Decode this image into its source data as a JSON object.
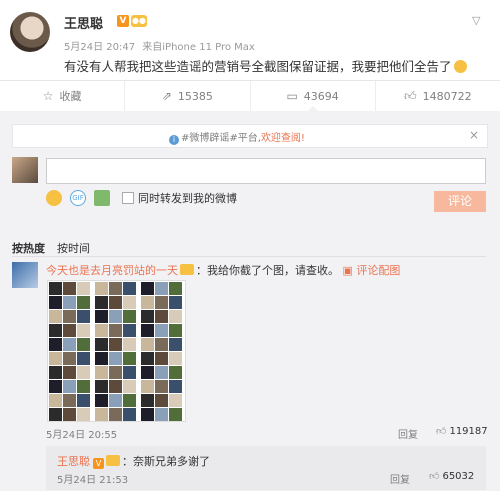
{
  "post": {
    "author": "王思聪",
    "verified_badge": "V",
    "meta_time": "5月24日 20:47",
    "meta_source_prefix": "来自",
    "meta_device": "iPhone 11 Pro Max",
    "text": "有没有人帮我把这些造谣的营销号全截图保留证据，我要把他们全告了",
    "icons": {
      "avatar": "avatar",
      "dropdown": "chevron-down-icon",
      "emoji": "smile-emoji"
    }
  },
  "actions": [
    {
      "label": "收藏",
      "icon": "star-icon"
    },
    {
      "label": "15385",
      "icon": "share-icon"
    },
    {
      "label": "43694",
      "icon": "comment-icon"
    },
    {
      "label": "1480722",
      "icon": "thumbs-up-icon"
    }
  ],
  "notice": {
    "text_prefix": "#微博辟谣#平台,",
    "link": "欢迎查阅!"
  },
  "composer": {
    "input_value": "",
    "repost_checkbox_label": "同时转发到我的微博",
    "send_label": "评论"
  },
  "sort": {
    "hot": "按热度",
    "time": "按时间"
  },
  "comment": {
    "nick": "今天也是去月亮罚站的一天",
    "text": "：我给你截了个图，请查收。",
    "pic_link": "评论配图",
    "date": "5月24日 20:55",
    "reply_label": "回复",
    "likes": "119187"
  },
  "reply": {
    "nick": "王思聪",
    "badge": "V",
    "text": "：奈斯兄弟多谢了",
    "date": "5月24日 21:53",
    "reply_label": "回复",
    "likes": "65032"
  },
  "colors": {
    "accent": "#eb7350",
    "badge_orange": "#f7941d",
    "muted": "#808080",
    "bg": "#f2f2f5"
  }
}
